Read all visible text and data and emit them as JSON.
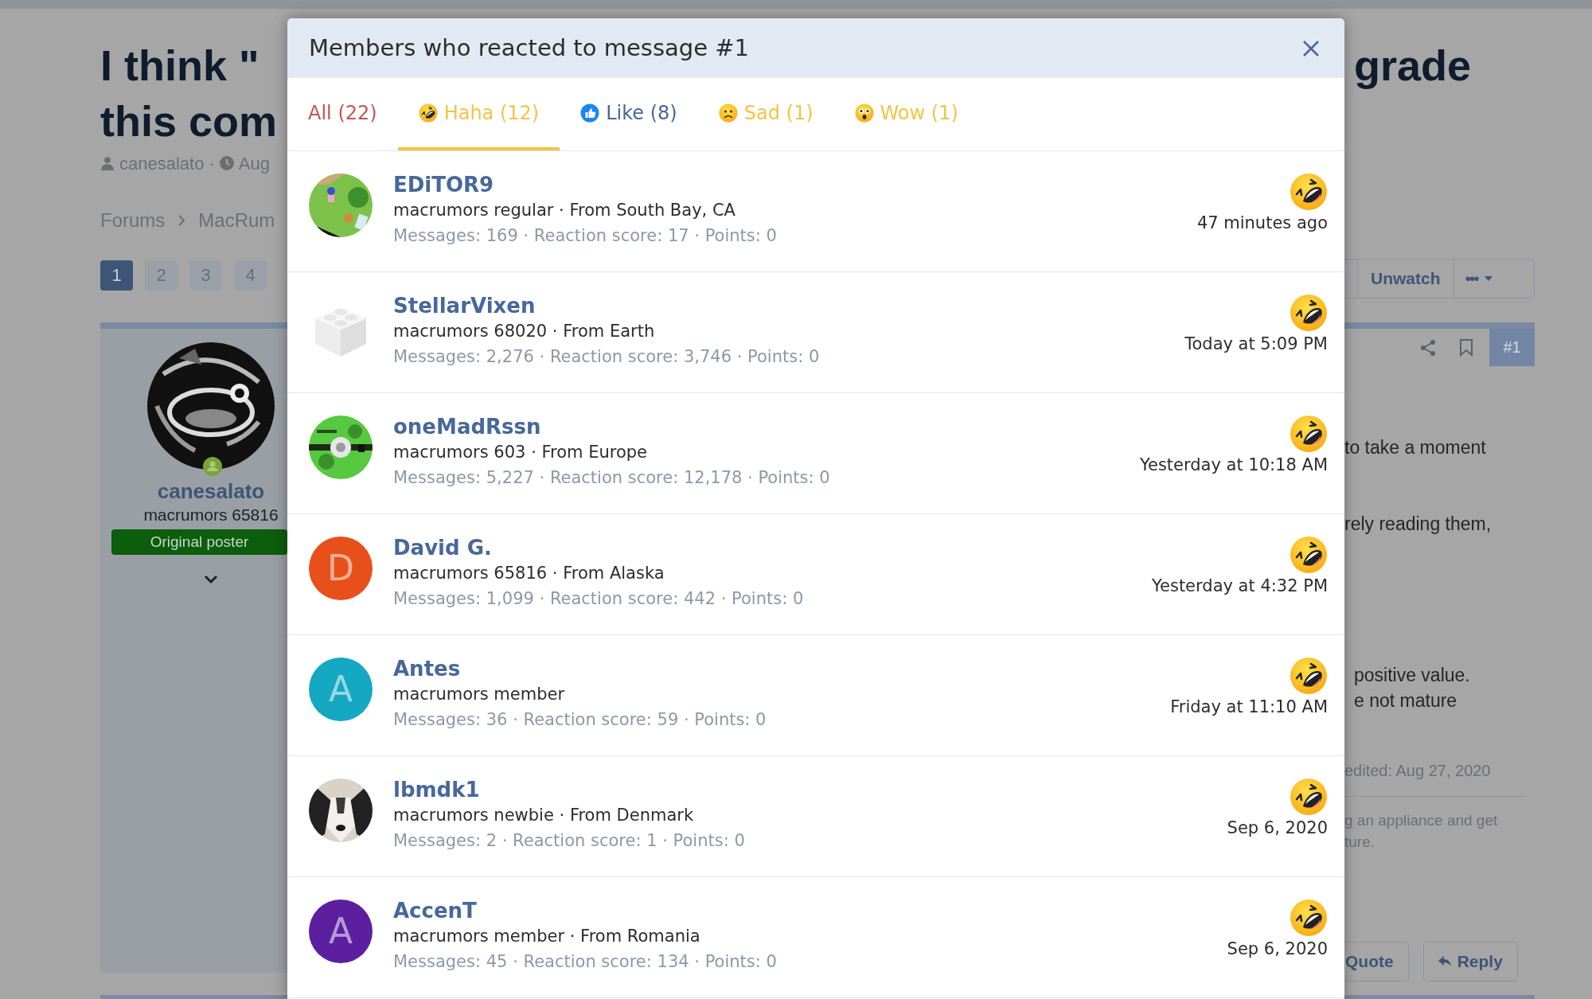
{
  "page": {
    "title_left": [
      "I think \"",
      "this com"
    ],
    "title_right": "grade",
    "meta": {
      "author": "canesalato",
      "separator": "·",
      "date": "Aug"
    },
    "breadcrumb": [
      "Forums",
      "MacRum"
    ],
    "pages": [
      {
        "label": "1",
        "selected": true
      },
      {
        "label": "2",
        "selected": false
      },
      {
        "label": "3",
        "selected": false
      },
      {
        "label": "4",
        "selected": false
      }
    ],
    "post": {
      "author": "canesalato",
      "user_title": "macrumors 65816",
      "banner": "Original poster",
      "watch_button": "Unwatch",
      "more_button": "•••",
      "post_number": "#1",
      "paragraphs": [
        [
          "to take a moment"
        ],
        [
          "rely reading them,"
        ],
        [
          "positive value.",
          "e not mature"
        ]
      ],
      "edited": "edited: Aug 27, 2020",
      "signature_lines": [
        "g an appliance and get",
        "ture."
      ],
      "buttons": [
        "Quote",
        "Reply"
      ]
    }
  },
  "dialog": {
    "title": "Members who reacted to message #1",
    "tabs": [
      {
        "label": "All (22)",
        "selected": false,
        "color": "#c65454"
      },
      {
        "label": "Haha (12)",
        "selected": true,
        "color": "#f5c344"
      },
      {
        "label": "Like (8)",
        "selected": false,
        "color": "#47689a"
      },
      {
        "label": "Sad (1)",
        "selected": false,
        "color": "#f5c344"
      },
      {
        "label": "Wow (1)",
        "selected": false,
        "color": "#f5c344"
      }
    ],
    "members": [
      {
        "name": "EDiTOR9",
        "user_line": "macrumors regular · From South Bay, CA",
        "stats": "Messages: 169 · Reaction score: 17 · Points: 0",
        "time": "47 minutes ago"
      },
      {
        "name": "StellarVixen",
        "user_line": "macrumors 68020 · From Earth",
        "stats": "Messages: 2,276 · Reaction score: 3,746 · Points: 0",
        "time": "Today at 5:09 PM"
      },
      {
        "name": "oneMadRssn",
        "user_line": "macrumors 603 · From Europe",
        "stats": "Messages: 5,227 · Reaction score: 12,178 · Points: 0",
        "time": "Yesterday at 10:18 AM"
      },
      {
        "name": "David G.",
        "avatar": {
          "kind": "letter",
          "letter": "D",
          "color": "#e8501b"
        },
        "user_line": "macrumors 65816 · From Alaska",
        "stats": "Messages: 1,099 · Reaction score: 442 · Points: 0",
        "time": "Yesterday at 4:32 PM"
      },
      {
        "name": "Antes",
        "avatar": {
          "kind": "letter",
          "letter": "A",
          "color": "#14a8c2"
        },
        "user_line": "macrumors member",
        "stats": "Messages: 36 · Reaction score: 59 · Points: 0",
        "time": "Friday at 11:10 AM"
      },
      {
        "name": "lbmdk1",
        "user_line": "macrumors newbie · From Denmark",
        "stats": "Messages: 2 · Reaction score: 1 · Points: 0",
        "time": "Sep 6, 2020"
      },
      {
        "name": "AccenT",
        "avatar": {
          "kind": "letter",
          "letter": "A",
          "color": "#5b1fa0"
        },
        "user_line": "macrumors member · From Romania",
        "stats": "Messages: 45 · Reaction score: 134 · Points: 0",
        "time": "Sep 6, 2020"
      }
    ]
  }
}
